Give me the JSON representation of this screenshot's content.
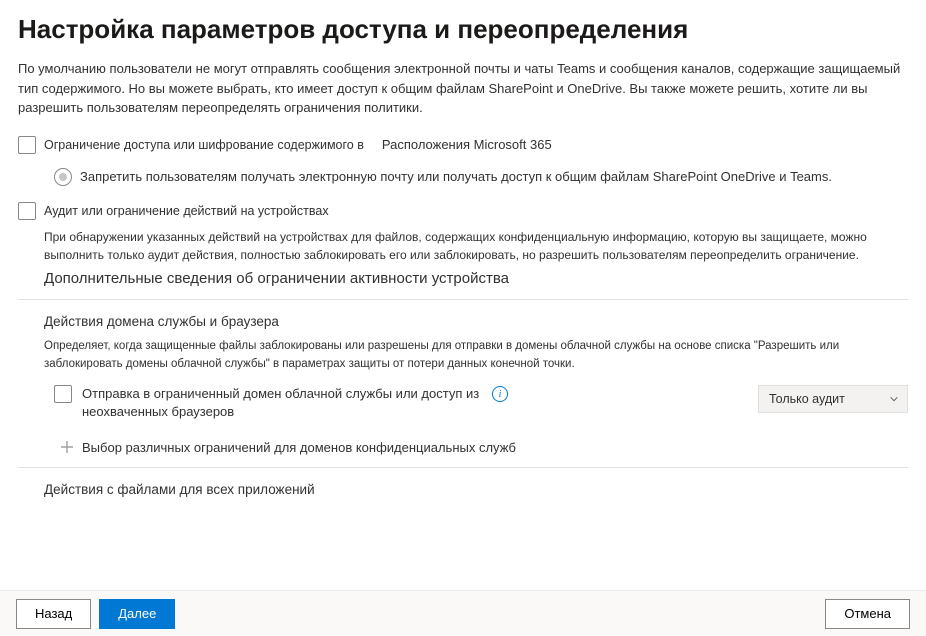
{
  "title": "Настройка параметров доступа и переопределения",
  "intro": "По умолчанию пользователи не могут отправлять сообщения электронной почты и чаты Teams и сообщения каналов, содержащие защищаемый тип содержимого. Но вы можете выбрать, кто имеет доступ к общим файлам SharePoint и OneDrive. Вы также можете решить, хотите ли вы разрешить пользователям переопределять ограничения политики.",
  "sec1": {
    "checkbox_label": "Ограничение доступа или шифрование содержимого в",
    "tag": "Расположения Microsoft 365",
    "radio_label": "Запретить пользователям получать электронную почту или получать доступ к общим файлам SharePoint OneDrive и Teams."
  },
  "sec2": {
    "checkbox_label": "Аудит или ограничение действий на устройствах",
    "desc": "При обнаружении указанных действий на устройствах для файлов, содержащих конфиденциальную информацию, которую вы защищаете, можно выполнить только аудит действия, полностью заблокировать его или заблокировать, но разрешить пользователям переопределить ограничение.",
    "link": "Дополнительные сведения об ограничении активности устройства"
  },
  "sec3": {
    "title": "Действия домена службы и браузера",
    "desc": "Определяет, когда защищенные файлы заблокированы или разрешены для отправки в домены облачной службы на основе списка \"Разрешить или заблокировать домены облачной службы\" в параметрах защиты от потери данных конечной точки.",
    "opt_label": "Отправка в ограниченный домен облачной службы или доступ из неохваченных браузеров",
    "dropdown": "Только аудит",
    "add_label": "Выбор различных ограничений для доменов конфиденциальных служб"
  },
  "sec4": {
    "title": "Действия с файлами для всех приложений"
  },
  "footer": {
    "back": "Назад",
    "next": "Далее",
    "cancel": "Отмена"
  }
}
